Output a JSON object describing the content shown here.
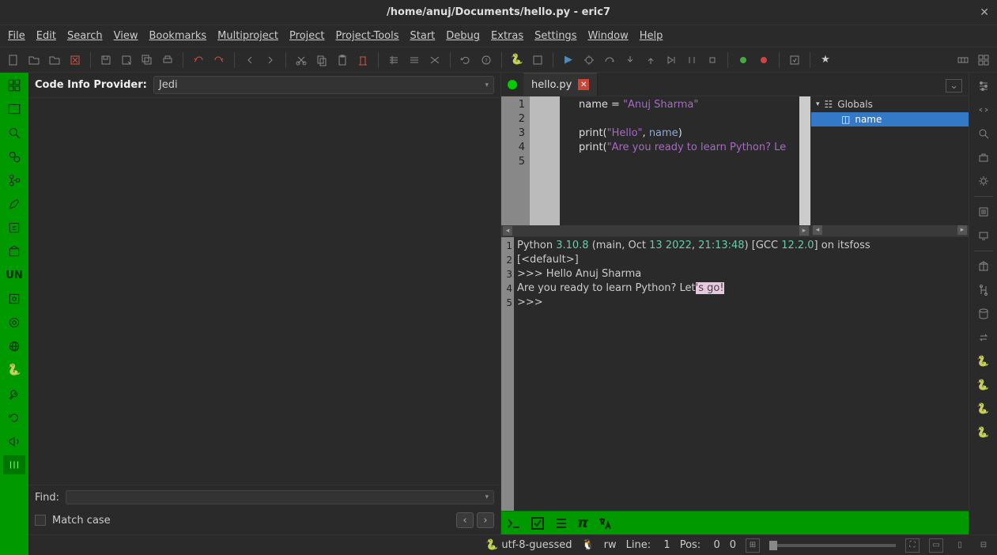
{
  "window": {
    "title": "/home/anuj/Documents/hello.py - eric7"
  },
  "menu": {
    "file": "File",
    "edit": "Edit",
    "search": "Search",
    "view": "View",
    "bookmarks": "Bookmarks",
    "multiproject": "Multiproject",
    "project": "Project",
    "project_tools": "Project-Tools",
    "start": "Start",
    "debug": "Debug",
    "extras": "Extras",
    "settings": "Settings",
    "window": "Window",
    "help": "Help"
  },
  "code_info": {
    "label": "Code Info Provider:",
    "value": "Jedi"
  },
  "find": {
    "label": "Find:",
    "value": "",
    "match_case": "Match case"
  },
  "tab": {
    "name": "hello.py"
  },
  "code": {
    "lines": [
      "1",
      "2",
      "3",
      "4",
      "5"
    ],
    "l1_var": "name",
    "l1_eq": " = ",
    "l1_str": "\"Anuj Sharma\"",
    "l3_fn": "print(",
    "l3_str": "\"Hello\"",
    "l3_mid": ", ",
    "l3_var": "name",
    "l3_end": ")",
    "l4_fn": "print(",
    "l4_str": "\"Are you ready to learn Python? Le"
  },
  "outline": {
    "root": "Globals",
    "item": "name"
  },
  "shell": {
    "lines": [
      "1",
      "2",
      "3",
      "4",
      "5"
    ],
    "l1_a": "Python ",
    "l1_ver": "3.10.8",
    "l1_b": " (main, Oct ",
    "l1_d": "13 2022",
    "l1_c": ", ",
    "l1_t": "21:13:48",
    "l1_e": ") [GCC ",
    "l1_g": "12.2.0",
    "l1_f": "] on itsfoss",
    "l2": "[<default>]",
    "l3": ">>> Hello Anuj Sharma",
    "l4_a": "Are you ready to learn Python? Let",
    "l4_b": "'s go!",
    "l5": ">>> "
  },
  "status": {
    "encoding": "utf-8-guessed",
    "rw": "rw",
    "line_lbl": "Line:",
    "line": "1",
    "pos_lbl": "Pos:",
    "pos": "0",
    "sel": "0"
  }
}
